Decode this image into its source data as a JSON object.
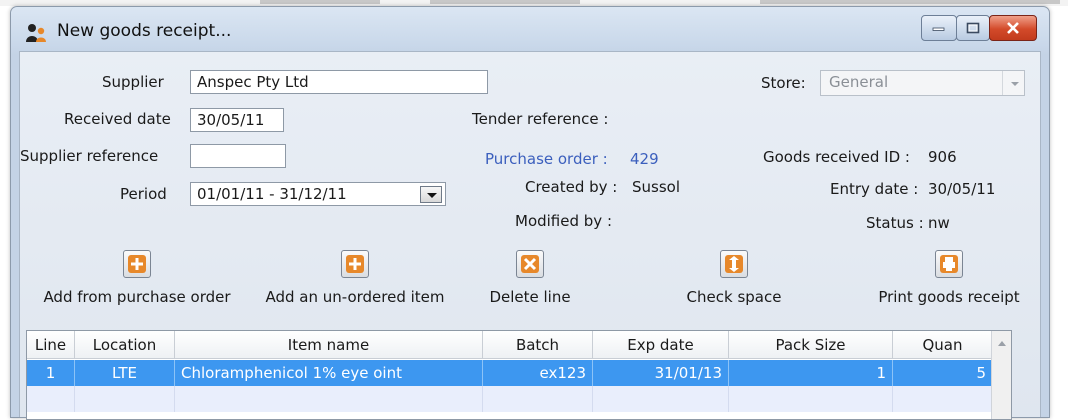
{
  "window": {
    "title": "New goods receipt..."
  },
  "form": {
    "supplier_label": "Supplier",
    "supplier_value": "Anspec Pty Ltd",
    "received_date_label": "Received date",
    "received_date_value": "30/05/11",
    "supplier_reference_label": "Supplier reference",
    "supplier_reference_value": "",
    "period_label": "Period",
    "period_value": "01/01/11 - 31/12/11",
    "tender_reference_label": "Tender reference :",
    "purchase_order_label": "Purchase order :",
    "purchase_order_value": "429",
    "created_by_label": "Created by :",
    "created_by_value": "Sussol",
    "modified_by_label": "Modified by :",
    "store_label": "Store:",
    "store_value": "General",
    "goods_received_id_label": "Goods received ID :",
    "goods_received_id_value": "906",
    "entry_date_label": "Entry date :",
    "entry_date_value": "30/05/11",
    "status_label": "Status :",
    "status_value": "nw"
  },
  "toolbar": {
    "add_from_po": "Add from purchase order",
    "add_unordered": "Add an un-ordered item",
    "delete_line": "Delete line",
    "check_space": "Check space",
    "print_receipt": "Print goods receipt"
  },
  "table": {
    "columns": [
      "Line",
      "Location",
      "Item name",
      "Batch",
      "Exp date",
      "Pack Size",
      "Quan"
    ],
    "rows": [
      {
        "line": "1",
        "location": "LTE",
        "item_name": "Chloramphenicol 1% eye oint",
        "batch": "ex123",
        "exp_date": "31/01/13",
        "pack_size": "1",
        "quantity": "5"
      }
    ]
  },
  "icons": {
    "app": "people-icon",
    "add": "plus-icon",
    "delete": "x-icon",
    "check": "arrow-icon",
    "print": "print-icon"
  },
  "colors": {
    "accent_orange": "#e7882a",
    "selection_blue": "#3d97f0",
    "link_blue": "#3b5fbd"
  }
}
